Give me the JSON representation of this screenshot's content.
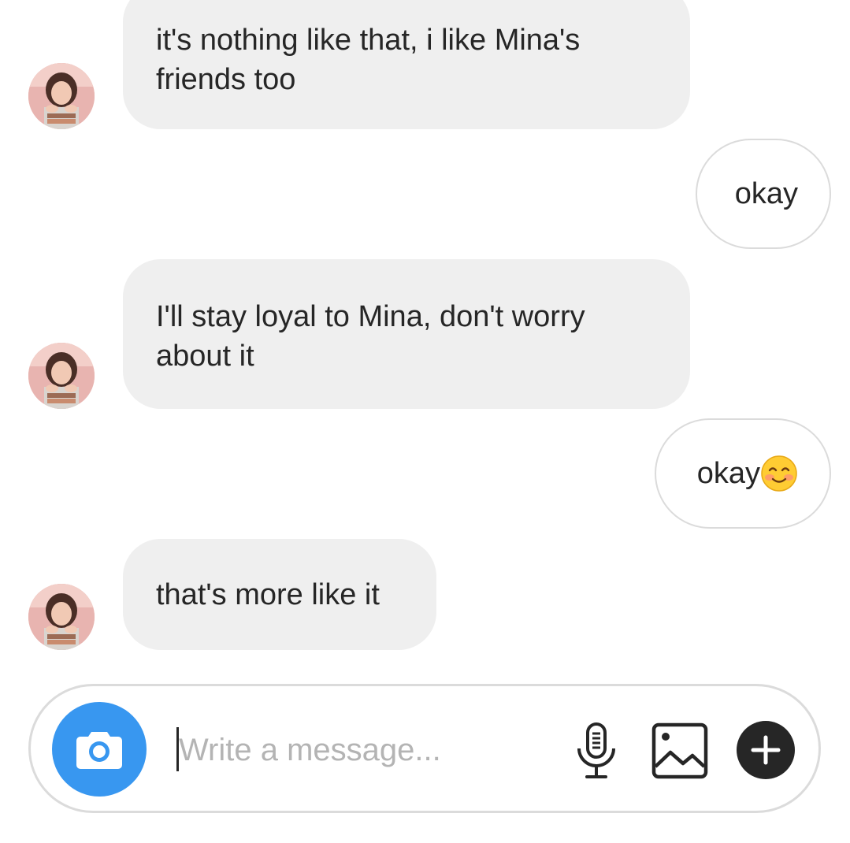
{
  "thread": {
    "messages": [
      {
        "direction": "in",
        "lines": [
          "it's nothing like that, i like Mina's",
          "friends too"
        ]
      },
      {
        "direction": "out",
        "text": "okay"
      },
      {
        "direction": "in",
        "lines": [
          "I'll stay loyal to Mina, don't worry",
          "about it"
        ]
      },
      {
        "direction": "out",
        "text": "okay",
        "emoji": "smiling-face-with-smiling-eyes-emoji"
      },
      {
        "direction": "in",
        "lines": [
          "that's more like it"
        ]
      }
    ]
  },
  "composer": {
    "placeholder": "Write a message...",
    "value": "",
    "camera_icon": "camera-icon",
    "mic_icon": "microphone-icon",
    "gallery_icon": "gallery-icon",
    "add_icon": "plus-icon",
    "accent_color": "#3897f0"
  },
  "colors": {
    "incoming_bubble": "#efefef",
    "outgoing_border": "#dbdbdb",
    "text": "#262626"
  }
}
